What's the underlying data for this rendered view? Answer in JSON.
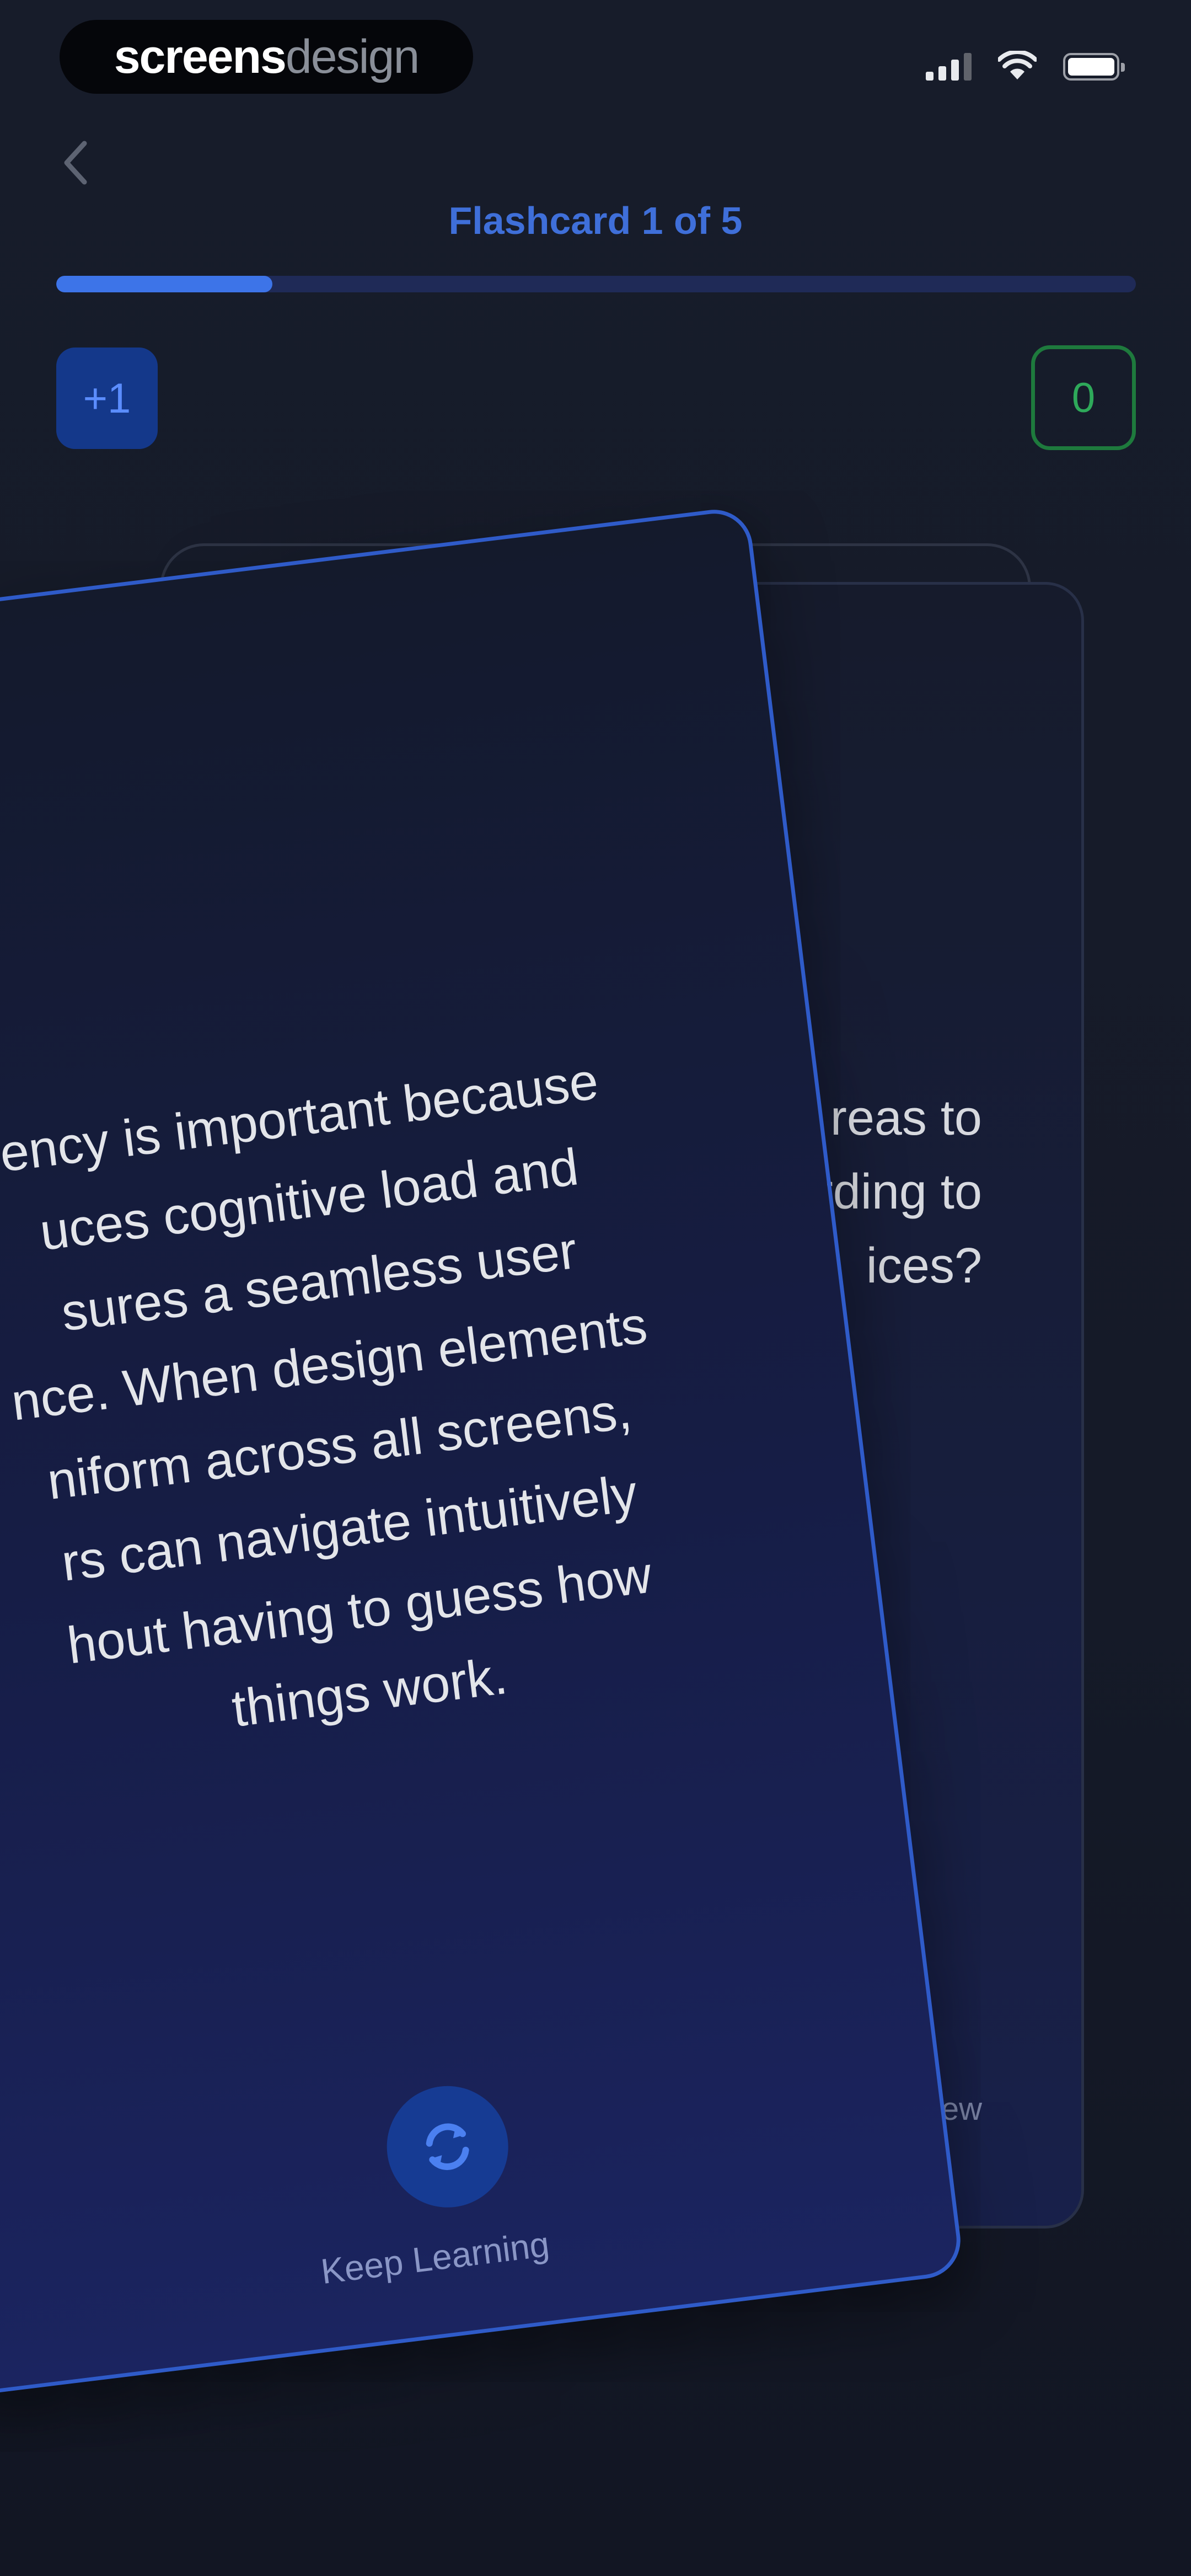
{
  "status_bar": {
    "brand_bold": "screens",
    "brand_light": "design",
    "icons": [
      "signal-icon",
      "wifi-icon",
      "battery-icon"
    ]
  },
  "header": {
    "title": "Flashcard 1 of 5",
    "progress": 0.2
  },
  "counters": {
    "left_value": "+1",
    "right_value": "0"
  },
  "back_card": {
    "text": "reas to\ncording to\nices?",
    "action_label": "view"
  },
  "front_card": {
    "text": "ency is important because\nuces cognitive load and\nsures a seamless user\nnce. When design elements\nniform across all screens,\nrs can navigate intuitively\nhout having to guess how\nthings work.",
    "action_label": "Keep Learning",
    "action_icon": "refresh-icon"
  },
  "colors": {
    "accent": "#3d74e8",
    "success": "#2ea95a",
    "background": "#151a28"
  }
}
